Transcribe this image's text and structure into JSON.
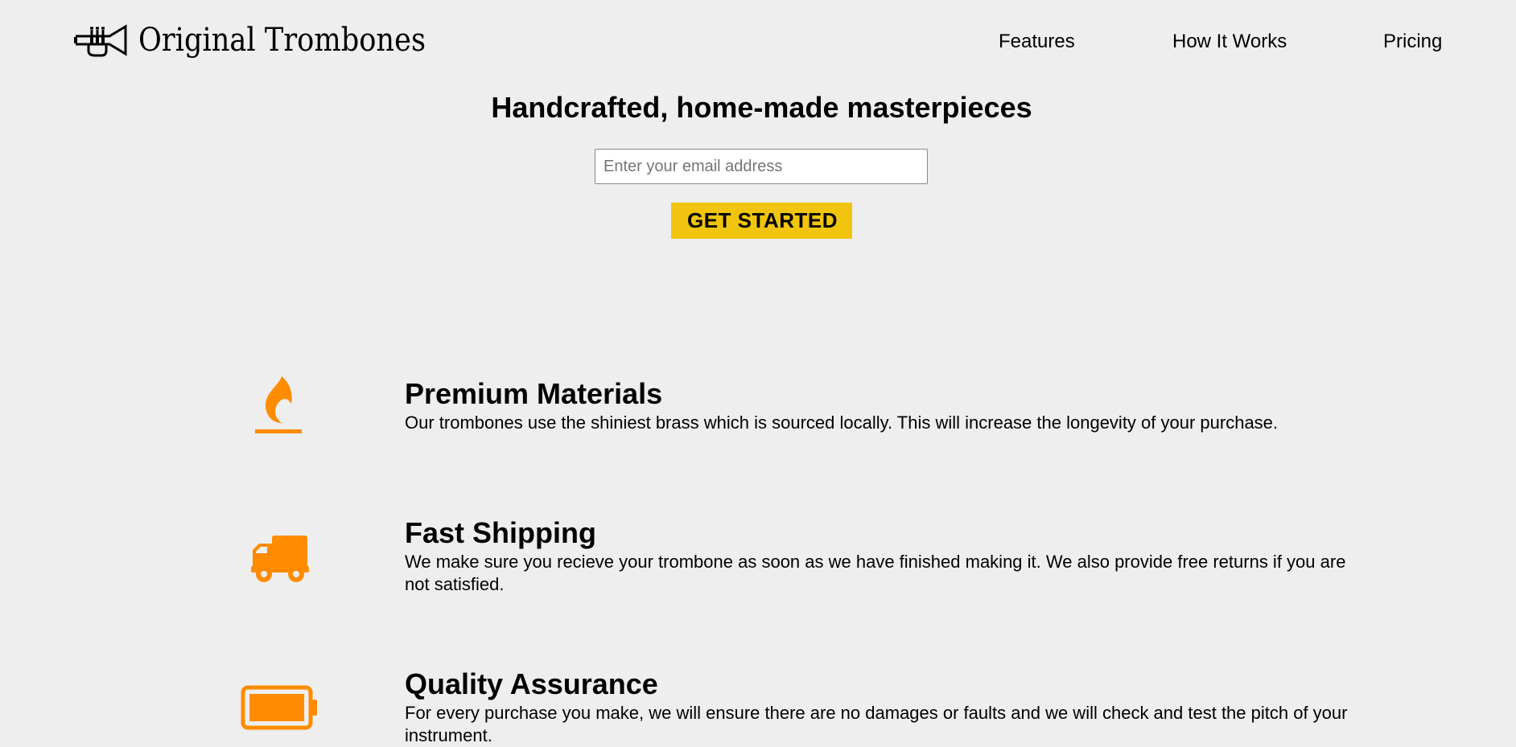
{
  "brand": {
    "name": "Original Trombones",
    "logo_icon": "trumpet-icon"
  },
  "nav": {
    "items": [
      {
        "label": "Features"
      },
      {
        "label": "How It Works"
      },
      {
        "label": "Pricing"
      }
    ]
  },
  "hero": {
    "title": "Handcrafted, home-made masterpieces",
    "email_placeholder": "Enter your email address",
    "email_value": "",
    "cta_label": "GET STARTED"
  },
  "features": [
    {
      "icon": "flame-icon",
      "title": "Premium Materials",
      "description": "Our trombones use the shiniest brass which is sourced locally. This will increase the longevity of your purchase."
    },
    {
      "icon": "truck-icon",
      "title": "Fast Shipping",
      "description": "We make sure you recieve your trombone as soon as we have finished making it. We also provide free returns if you are not satisfied."
    },
    {
      "icon": "battery-full-icon",
      "title": "Quality Assurance",
      "description": "For every purchase you make, we will ensure there are no damages or faults and we will check and test the pitch of your instrument."
    }
  ],
  "colors": {
    "background": "#eeeeee",
    "accent_button": "#f1c40f",
    "icon_orange": "#ff8c00",
    "text": "#000000"
  }
}
